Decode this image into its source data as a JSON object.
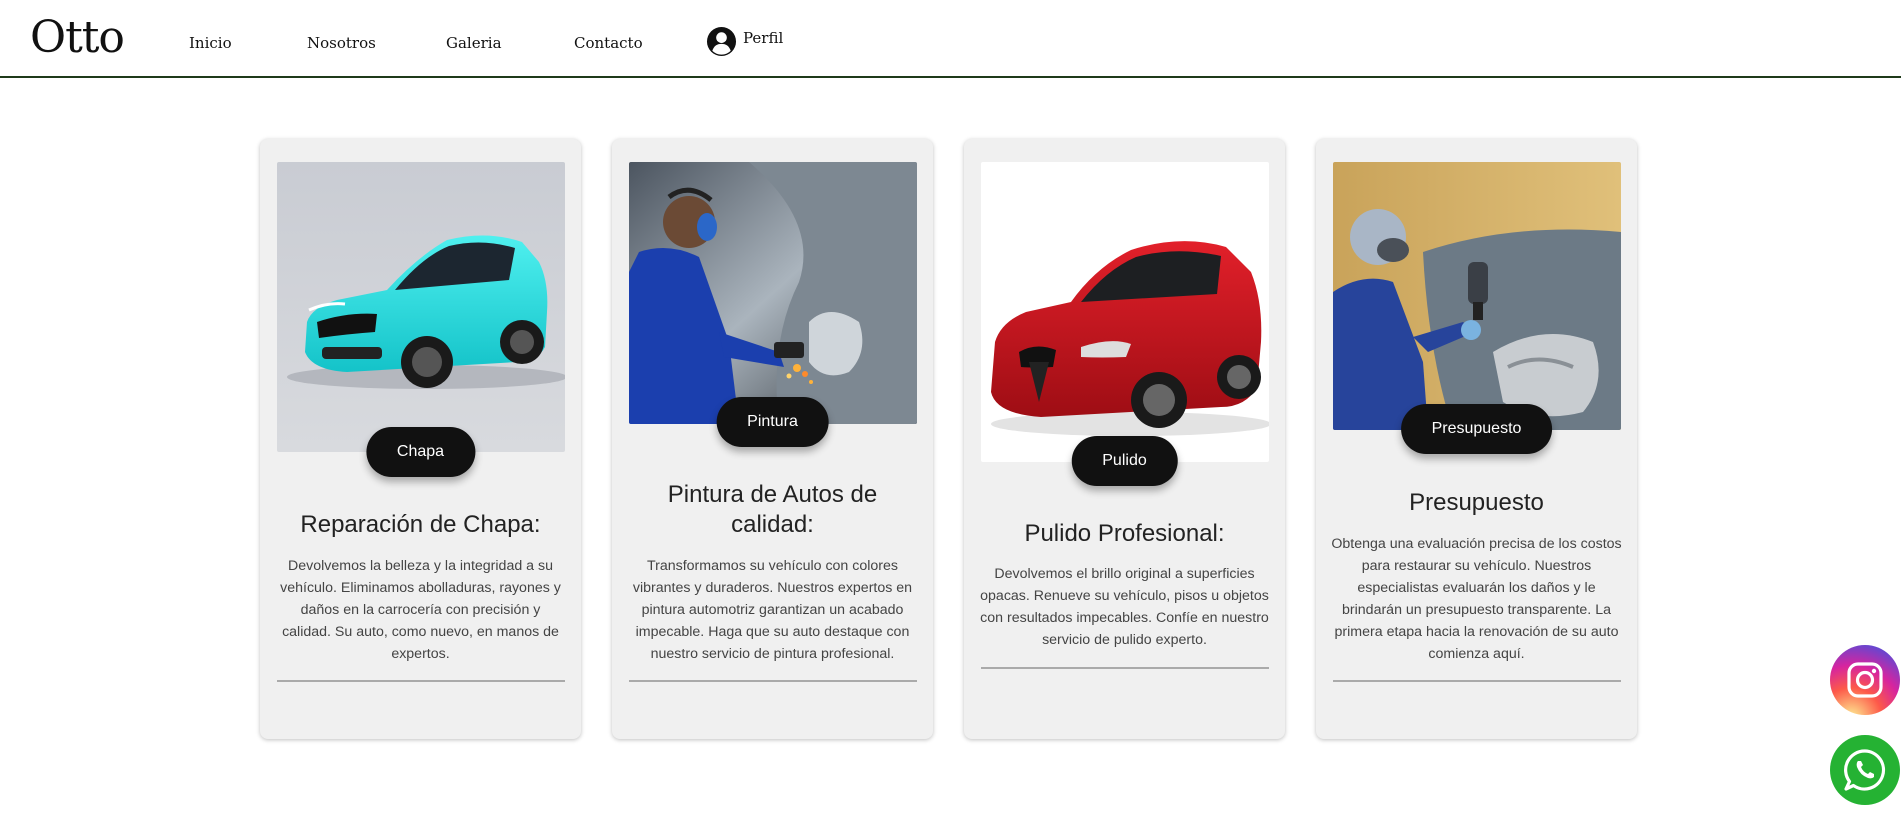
{
  "header": {
    "logo": "Otto",
    "nav": [
      "Inicio",
      "Nosotros",
      "Galeria",
      "Contacto"
    ],
    "profile_label": "Perfil"
  },
  "cards": [
    {
      "badge": "Chapa",
      "title": "Reparación de Chapa:",
      "text": "Devolvemos la belleza y la integridad a su vehículo. Eliminamos abolladuras, rayones y daños en la carrocería con precisión y calidad. Su auto, como nuevo, en manos de expertos.",
      "image_icon": "turquoise-car-photo"
    },
    {
      "badge": "Pintura",
      "title": "Pintura de Autos de calidad:",
      "text": "Transformamos su vehículo con colores vibrantes y duraderos. Nuestros expertos en pintura automotriz garantizan un acabado impecable. Haga que su auto destaque con nuestro servicio de pintura profesional.",
      "image_icon": "mechanic-grinding-photo"
    },
    {
      "badge": "Pulido",
      "title": "Pulido Profesional:",
      "text": "Devolvemos el brillo original a superficies opacas. Renueve su vehículo, pisos u objetos con resultados impecables. Confíe en nuestro servicio de pulido experto.",
      "image_icon": "red-car-photo"
    },
    {
      "badge": "Presupuesto",
      "title": "Presupuesto",
      "text": "Obtenga una evaluación precisa de los costos para restaurar su vehículo. Nuestros especialistas evaluarán los daños y le brindarán un presupuesto transparente. La primera etapa hacia la renovación de su auto comienza aquí.",
      "image_icon": "painter-spraying-photo"
    }
  ],
  "floating": {
    "instagram_icon": "instagram-icon",
    "whatsapp_icon": "whatsapp-icon"
  },
  "colors": {
    "header_border": "#1f3a1a",
    "card_bg": "#f0f0f0",
    "pill_bg": "#111111",
    "whatsapp": "#25b233"
  }
}
